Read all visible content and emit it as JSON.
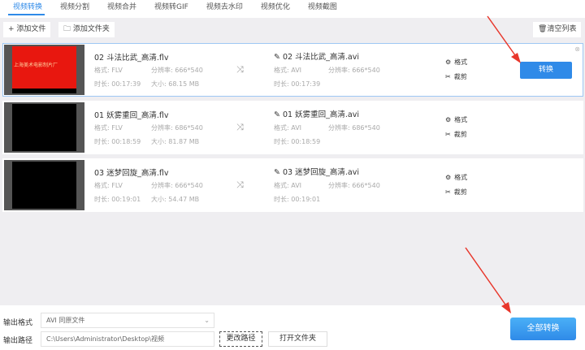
{
  "tabs": [
    "视频转换",
    "视频分割",
    "视频合并",
    "视频转GIF",
    "视频去水印",
    "视频优化",
    "视频截图"
  ],
  "toolbar": {
    "add_file": "+ 添加文件",
    "add_folder": "添加文件夹",
    "clear_list": "清空列表"
  },
  "labels": {
    "format": "格式:",
    "resolution": "分辨率:",
    "duration": "时长:",
    "size": "大小:",
    "format_action": "格式",
    "crop_action": "裁剪",
    "convert": "转换"
  },
  "files": [
    {
      "name": "02 斗法比武_高清.flv",
      "format": "FLV",
      "resolution": "666*540",
      "duration": "00:17:39",
      "size": "68.15 MB",
      "out_name": "02 斗法比武_高清.avi",
      "out_format": "AVI",
      "out_resolution": "666*540",
      "out_duration": "00:17:39",
      "thumb_text": "上海美术电影制片厂",
      "selected": true
    },
    {
      "name": "01 妖雾重回_高清.flv",
      "format": "FLV",
      "resolution": "686*540",
      "duration": "00:18:59",
      "size": "81.87 MB",
      "out_name": "01 妖雾重回_高清.avi",
      "out_format": "AVI",
      "out_resolution": "686*540",
      "out_duration": "00:18:59",
      "selected": false
    },
    {
      "name": "03 迷梦回旋_高清.flv",
      "format": "FLV",
      "resolution": "666*540",
      "duration": "00:19:01",
      "size": "54.47 MB",
      "out_name": "03 迷梦回旋_高清.avi",
      "out_format": "AVI",
      "out_resolution": "666*540",
      "out_duration": "00:19:01",
      "selected": false
    }
  ],
  "bottom": {
    "format_label": "输出格式",
    "format_value": "AVI 同原文件",
    "path_label": "输出路径",
    "path_value": "C:\\Users\\Administrator\\Desktop\\视频",
    "change_path": "更改路径",
    "open_folder": "打开文件夹",
    "convert_all": "全部转换"
  },
  "colors": {
    "accent": "#2f8ae8",
    "arrow": "#e8362b"
  }
}
